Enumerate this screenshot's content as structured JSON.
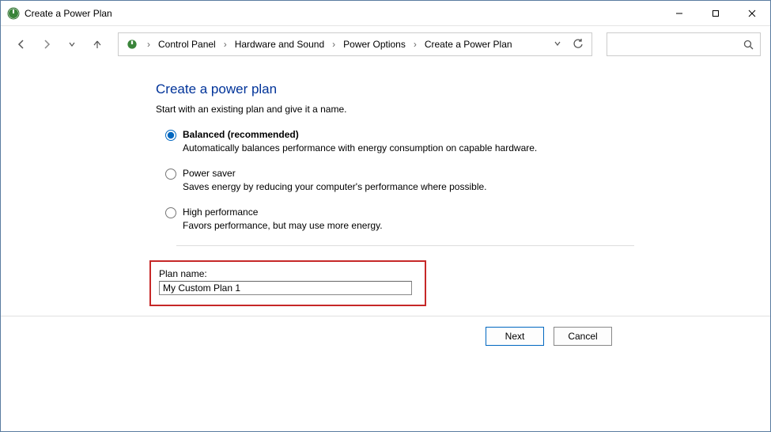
{
  "window": {
    "title": "Create a Power Plan"
  },
  "breadcrumb": {
    "items": [
      "Control Panel",
      "Hardware and Sound",
      "Power Options",
      "Create a Power Plan"
    ]
  },
  "page": {
    "heading": "Create a power plan",
    "subheading": "Start with an existing plan and give it a name."
  },
  "plans": [
    {
      "label": "Balanced (recommended)",
      "desc": "Automatically balances performance with energy consumption on capable hardware.",
      "checked": true
    },
    {
      "label": "Power saver",
      "desc": "Saves energy by reducing your computer's performance where possible.",
      "checked": false
    },
    {
      "label": "High performance",
      "desc": "Favors performance, but may use more energy.",
      "checked": false
    }
  ],
  "plan_name": {
    "label": "Plan name:",
    "value": "My Custom Plan 1"
  },
  "buttons": {
    "next": "Next",
    "cancel": "Cancel"
  }
}
